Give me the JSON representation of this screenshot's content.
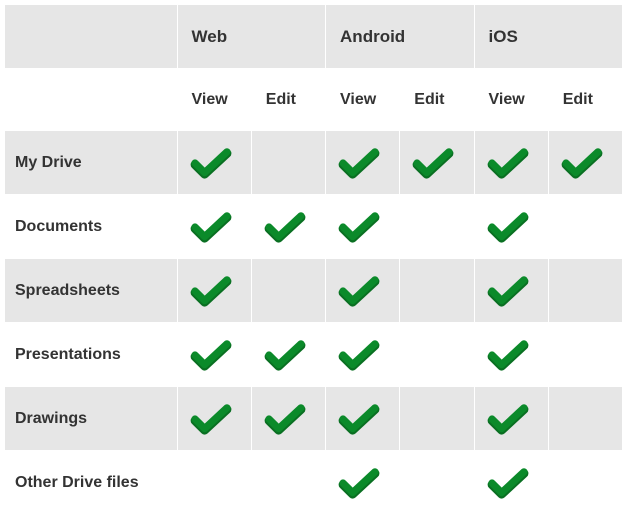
{
  "platforms": [
    {
      "key": "web",
      "label": "Web"
    },
    {
      "key": "android",
      "label": "Android"
    },
    {
      "key": "ios",
      "label": "iOS"
    }
  ],
  "capabilities": [
    {
      "key": "view",
      "label": "View"
    },
    {
      "key": "edit",
      "label": "Edit"
    }
  ],
  "features": [
    {
      "key": "mydrive",
      "label": "My Drive"
    },
    {
      "key": "documents",
      "label": "Documents"
    },
    {
      "key": "spreadsheets",
      "label": "Spreadsheets"
    },
    {
      "key": "presentations",
      "label": "Presentations"
    },
    {
      "key": "drawings",
      "label": "Drawings"
    },
    {
      "key": "other",
      "label": "Other Drive files"
    }
  ],
  "chart_data": {
    "type": "table",
    "title": "",
    "columns": [
      "Web View",
      "Web Edit",
      "Android View",
      "Android Edit",
      "iOS View",
      "iOS Edit"
    ],
    "rows": [
      "My Drive",
      "Documents",
      "Spreadsheets",
      "Presentations",
      "Drawings",
      "Other Drive files"
    ],
    "matrix": [
      [
        true,
        false,
        true,
        true,
        true,
        true
      ],
      [
        true,
        true,
        true,
        false,
        true,
        false
      ],
      [
        true,
        false,
        true,
        false,
        true,
        false
      ],
      [
        true,
        true,
        true,
        false,
        true,
        false
      ],
      [
        true,
        true,
        true,
        false,
        true,
        false
      ],
      [
        false,
        false,
        true,
        false,
        true,
        false
      ]
    ]
  },
  "colors": {
    "check": "#0b8a2a",
    "check_shadow": "#0a6f22",
    "row_alt_bg": "#e6e6e6"
  }
}
